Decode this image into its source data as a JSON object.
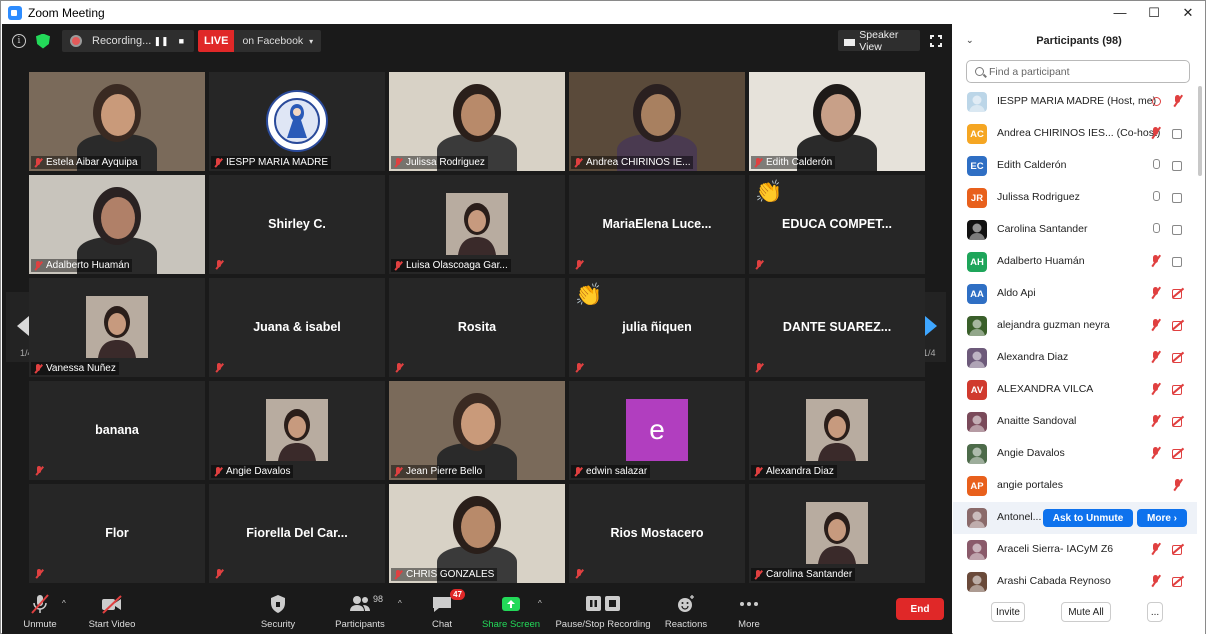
{
  "window": {
    "title": "Zoom Meeting",
    "minimize": "—",
    "maximize": "☐",
    "close": "✕"
  },
  "topbar": {
    "recording_label": "Recording...",
    "pause_glyph": "❚❚",
    "stop_glyph": "■",
    "live_label": "LIVE",
    "live_destination": "on Facebook",
    "live_caret": "▾",
    "speaker_view": "Speaker View"
  },
  "tiles": [
    {
      "name": "Estela Aibar Ayquipa",
      "kind": "video"
    },
    {
      "name": "IESPP MARIA MADRE",
      "kind": "logo"
    },
    {
      "name": "Julissa Rodriguez",
      "kind": "video",
      "active": true
    },
    {
      "name": "Andrea CHIRINOS IE...",
      "kind": "video"
    },
    {
      "name": "Edith Calderón",
      "kind": "video"
    },
    {
      "name": "Adalberto Huamán",
      "kind": "video"
    },
    {
      "name": "Shirley C.",
      "kind": "text"
    },
    {
      "name": "Luisa Olascoaga Gar...",
      "kind": "avatar"
    },
    {
      "name": "MariaElena  Luce...",
      "kind": "text"
    },
    {
      "name": "EDUCA  COMPET...",
      "kind": "text",
      "reaction": "clap"
    },
    {
      "name": "Vanessa Nuñez",
      "kind": "avatar"
    },
    {
      "name": "Juana & isabel",
      "kind": "text"
    },
    {
      "name": "Rosita",
      "kind": "text"
    },
    {
      "name": "julia ñiquen",
      "kind": "text",
      "reaction": "clap"
    },
    {
      "name": "DANTE SUAREZ...",
      "kind": "text"
    },
    {
      "name": "banana",
      "kind": "text"
    },
    {
      "name": "Angie Davalos",
      "kind": "avatar"
    },
    {
      "name": "Jean Pierre Bello",
      "kind": "video"
    },
    {
      "name": "edwin salazar",
      "kind": "letter",
      "letter": "e"
    },
    {
      "name": "Alexandra Diaz",
      "kind": "avatar"
    },
    {
      "name": "Flor",
      "kind": "text"
    },
    {
      "name": "Fiorella  Del  Car...",
      "kind": "text"
    },
    {
      "name": "CHRIS GONZALES",
      "kind": "video"
    },
    {
      "name": "Rios Mostacero",
      "kind": "text"
    },
    {
      "name": "Carolina Santander",
      "kind": "avatar"
    }
  ],
  "paging": {
    "left": "1/4",
    "right": "1/4"
  },
  "toolbar": {
    "unmute": "Unmute",
    "start_video": "Start Video",
    "security": "Security",
    "participants": "Participants",
    "participants_count": "98",
    "chat": "Chat",
    "chat_badge": "47",
    "share_screen": "Share Screen",
    "pause_stop_recording": "Pause/Stop Recording",
    "reactions": "Reactions",
    "more": "More",
    "end": "End",
    "caret": "^"
  },
  "panel": {
    "title": "Participants (98)",
    "collapse": "⌄",
    "search_placeholder": "Find a participant",
    "participants": [
      {
        "name": "IESPP MARIA MADRE (Host, me)",
        "initials": "",
        "color": "#bcd6e8",
        "icons": [
          "rec",
          "mic-off"
        ]
      },
      {
        "name": "Andrea CHIRINOS IES... (Co-host)",
        "initials": "AC",
        "color": "#f5a623",
        "icons": [
          "mic-off",
          "vid-on"
        ]
      },
      {
        "name": "Edith Calderón",
        "initials": "EC",
        "color": "#2f6fc4",
        "icons": [
          "mic-on",
          "vid-on"
        ]
      },
      {
        "name": "Julissa Rodriguez",
        "initials": "JR",
        "color": "#e8601c",
        "icons": [
          "mic-on",
          "vid-on"
        ]
      },
      {
        "name": "Carolina Santander",
        "initials": "",
        "color": "#111111",
        "icons": [
          "mic-on",
          "vid-on"
        ]
      },
      {
        "name": "Adalberto Huamán",
        "initials": "AH",
        "color": "#1ea55a",
        "icons": [
          "mic-off",
          "vid-on"
        ]
      },
      {
        "name": "Aldo Api",
        "initials": "AA",
        "color": "#2f6fc4",
        "icons": [
          "mic-off",
          "vid-off"
        ]
      },
      {
        "name": "alejandra guzman neyra",
        "initials": "",
        "color": "#3a5f2a",
        "icons": [
          "mic-off",
          "vid-off"
        ]
      },
      {
        "name": "Alexandra Diaz",
        "initials": "",
        "color": "#6d5a7a",
        "icons": [
          "mic-off",
          "vid-off"
        ]
      },
      {
        "name": "ALEXANDRA VILCA",
        "initials": "AV",
        "color": "#d03a2e",
        "icons": [
          "mic-off",
          "vid-off"
        ]
      },
      {
        "name": "Anaitte Sandoval",
        "initials": "",
        "color": "#7a4a5a",
        "icons": [
          "mic-off",
          "vid-off"
        ]
      },
      {
        "name": "Angie Davalos",
        "initials": "",
        "color": "#4d6b4a",
        "icons": [
          "mic-off",
          "vid-off"
        ]
      },
      {
        "name": "angie portales",
        "initials": "AP",
        "color": "#e8601c",
        "icons": [
          "mic-off"
        ]
      },
      {
        "name": "Antonel...",
        "initials": "",
        "color": "#8a6a6a",
        "icons": [],
        "hover": true
      },
      {
        "name": "Araceli Sierra- IACyM Z6",
        "initials": "",
        "color": "#8a5a6a",
        "icons": [
          "mic-off",
          "vid-off"
        ]
      },
      {
        "name": "Arashi Cabada Reynoso",
        "initials": "",
        "color": "#6a4a3a",
        "icons": [
          "mic-off",
          "vid-off"
        ]
      }
    ],
    "ask_to_unmute": "Ask to Unmute",
    "more": "More ›",
    "invite": "Invite",
    "mute_all": "Mute All",
    "ellipsis": "..."
  }
}
